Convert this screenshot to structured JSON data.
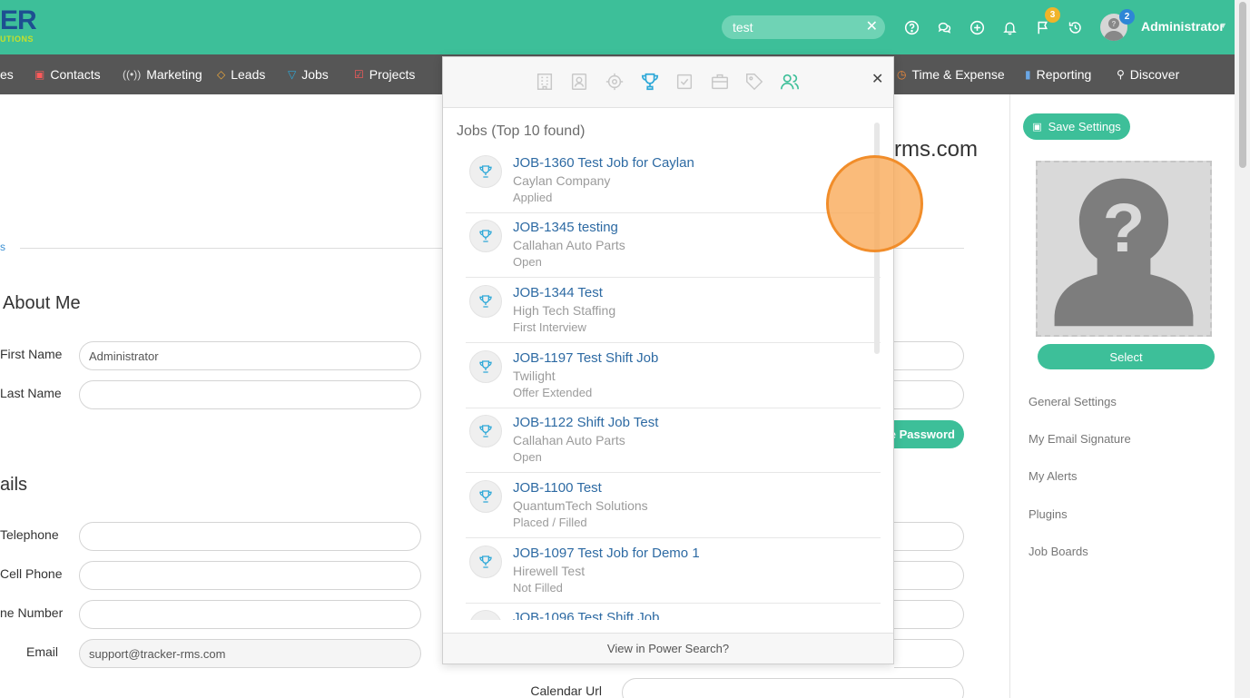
{
  "header": {
    "logo_text": "ER",
    "logo_sub": "UTIONS",
    "search": {
      "value": "test",
      "clear_icon": "close-icon"
    },
    "badges": {
      "flags": "3",
      "avatar": "2"
    },
    "user_name": "Administrator",
    "colors": {
      "brand": "#3dbf99",
      "nav": "#565656",
      "link": "#2d6aa3",
      "accent": "#2da8d8"
    }
  },
  "nav": {
    "items": [
      {
        "label": "es"
      },
      {
        "label": "Contacts",
        "icon": "contacts-icon",
        "color": "#ff5a5a"
      },
      {
        "label": "Marketing",
        "icon": "broadcast-icon",
        "color": "#dddddd"
      },
      {
        "label": "Leads",
        "icon": "leads-icon",
        "color": "#f0a93a"
      },
      {
        "label": "Jobs",
        "icon": "trophy-icon",
        "color": "#2da8d8"
      },
      {
        "label": "Projects",
        "icon": "check-square-icon",
        "color": "#ff5a5a"
      },
      {
        "label": "Time & Expense",
        "icon": "clock-icon",
        "color": "#f08a3a"
      },
      {
        "label": "Reporting",
        "icon": "bar-chart-icon",
        "color": "#6aa7e5"
      },
      {
        "label": "Discover",
        "icon": "search-icon",
        "color": "#ffffff"
      }
    ]
  },
  "main": {
    "heading_email": "rms.com",
    "tab_link": "s",
    "about_heading": "About Me",
    "first_name_label": "First Name",
    "first_name_value": "Administrator",
    "last_name_label": "Last Name",
    "last_name_value": "",
    "change_password_label": "e Password",
    "details_heading": "ails",
    "telephone_label": "Telephone",
    "cell_label": "Cell Phone",
    "phone_number_label": "ne Number",
    "email_label": "Email",
    "email_value": "support@tracker-rms.com",
    "calendar_label": "Calendar Url"
  },
  "sidebar": {
    "save_label": "Save Settings",
    "select_label": "Select",
    "links": [
      "General Settings",
      "My Email Signature",
      "My Alerts",
      "Plugins",
      "Job Boards"
    ]
  },
  "popup": {
    "results_title": "Jobs (Top 10 found)",
    "footer": "View in Power Search?",
    "categories": [
      "building-icon",
      "contact-card-icon",
      "target-icon",
      "trophy-icon",
      "check-square-icon",
      "briefcase-icon",
      "tag-icon",
      "people-icon"
    ],
    "results": [
      {
        "title": "JOB-1360 Test Job for Caylan",
        "company": "Caylan Company",
        "status": "Applied"
      },
      {
        "title": "JOB-1345 testing",
        "company": "Callahan Auto Parts",
        "status": "Open"
      },
      {
        "title": "JOB-1344 Test",
        "company": "High Tech Staffing",
        "status": "First Interview"
      },
      {
        "title": "JOB-1197 Test Shift Job",
        "company": "Twilight",
        "status": "Offer Extended"
      },
      {
        "title": "JOB-1122 Shift Job Test",
        "company": "Callahan Auto Parts",
        "status": "Open"
      },
      {
        "title": "JOB-1100 Test",
        "company": "QuantumTech Solutions",
        "status": "Placed / Filled"
      },
      {
        "title": "JOB-1097 Test Job for Demo 1",
        "company": "Hirewell Test",
        "status": "Not Filled"
      },
      {
        "title": "JOB-1096 Test Shift Job",
        "company": "",
        "status": ""
      }
    ]
  }
}
